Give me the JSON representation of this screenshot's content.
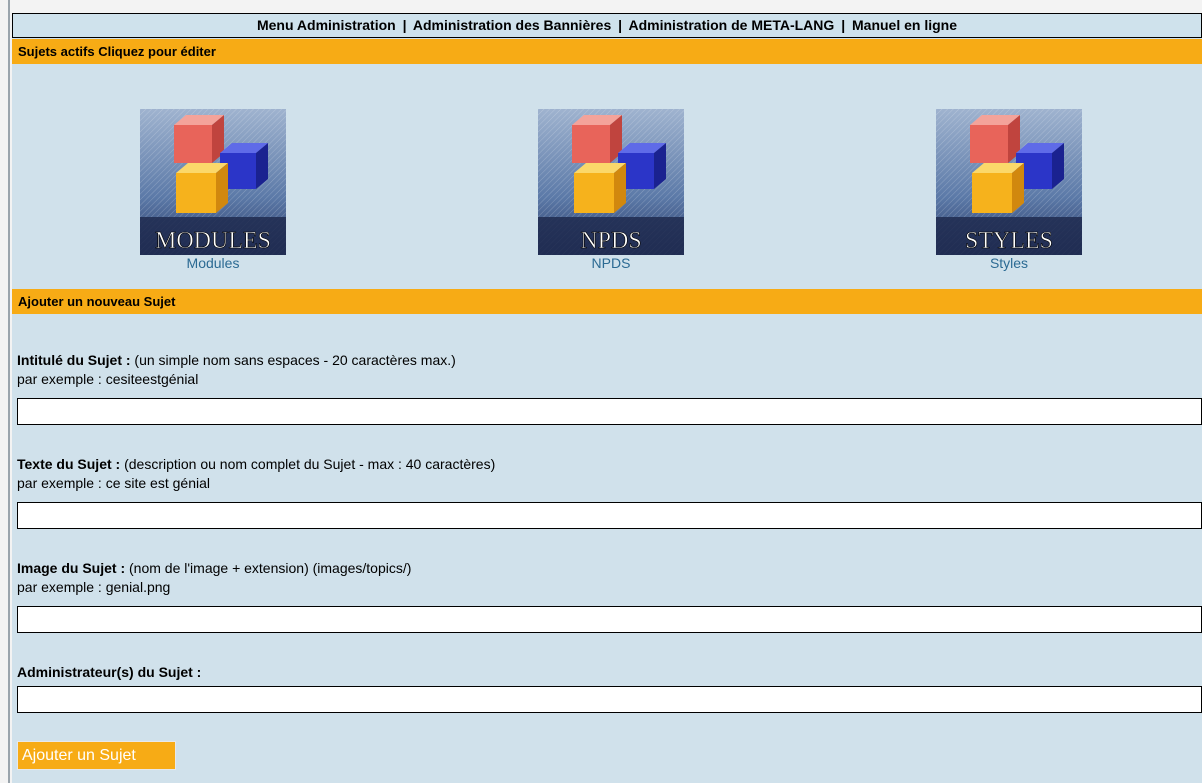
{
  "menu": {
    "items": [
      "Menu Administration",
      "Administration des Bannières",
      "Administration de META-LANG",
      "Manuel en ligne"
    ],
    "separator": "|"
  },
  "active_topics": {
    "heading": "Sujets actifs Cliquez pour éditer",
    "topics": [
      {
        "label": "Modules",
        "image_text": "MODULES"
      },
      {
        "label": "NPDS",
        "image_text": "NPDS"
      },
      {
        "label": "Styles",
        "image_text": "STYLES"
      }
    ]
  },
  "new_topic": {
    "heading": "Ajouter un nouveau Sujet",
    "fields": [
      {
        "label": "Intitulé du Sujet :",
        "hint": " (un simple nom sans espaces - 20 caractères max.)",
        "example": "par exemple : cesiteestgénial",
        "value": ""
      },
      {
        "label": "Texte du Sujet :",
        "hint": " (description ou nom complet du Sujet - max : 40 caractères)",
        "example": "par exemple : ce site est génial",
        "value": ""
      },
      {
        "label": "Image du Sujet :",
        "hint": " (nom de l'image + extension) (images/topics/)",
        "example": "par exemple : genial.png",
        "value": ""
      },
      {
        "label": "Administrateur(s) du Sujet :",
        "hint": "",
        "example": "",
        "value": ""
      }
    ],
    "submit_label": "Ajouter un Sujet"
  },
  "colors": {
    "page_bg": "#d0e1eb",
    "section_bar": "#f7ab15",
    "link": "#2b6a93"
  }
}
